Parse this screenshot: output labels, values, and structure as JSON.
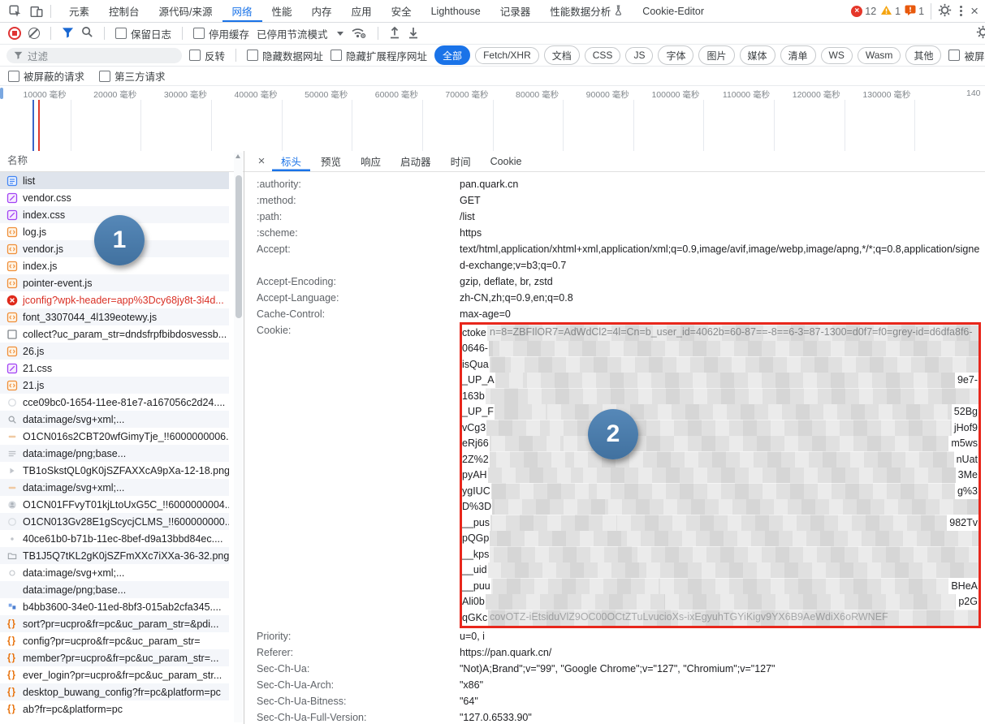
{
  "window": {
    "close_label": "×"
  },
  "tabs": {
    "active": "网络",
    "items": [
      {
        "label": "元素"
      },
      {
        "label": "控制台"
      },
      {
        "label": "源代码/来源"
      },
      {
        "label": "网络"
      },
      {
        "label": "性能"
      },
      {
        "label": "内存"
      },
      {
        "label": "应用"
      },
      {
        "label": "安全"
      },
      {
        "label": "Lighthouse"
      },
      {
        "label": "记录器"
      },
      {
        "label": "性能数据分析",
        "flask": true
      },
      {
        "label": "Cookie-Editor"
      }
    ]
  },
  "badges": {
    "errors": "12",
    "warnings": "1",
    "issues": "1"
  },
  "toolbar": {
    "preserve_log": "保留日志",
    "disable_cache": "停用缓存",
    "throttling": "已停用节流模式"
  },
  "filters": {
    "placeholder": "过滤",
    "invert": "反转",
    "hide_data_urls": "隐藏数据网址",
    "hide_extension_urls": "隐藏扩展程序网址",
    "chips": [
      "全部",
      "Fetch/XHR",
      "文档",
      "CSS",
      "JS",
      "字体",
      "图片",
      "媒体",
      "清单",
      "WS",
      "Wasm",
      "其他"
    ],
    "active_chip": "全部",
    "blocked_response_cookies": "被屏蔽的响应 Cookie",
    "blocked_requests": "被屏蔽的请求",
    "third_party": "第三方请求"
  },
  "timeline": {
    "tick_labels": [
      "10000 毫秒",
      "20000 毫秒",
      "30000 毫秒",
      "40000 毫秒",
      "50000 毫秒",
      "60000 毫秒",
      "70000 毫秒",
      "80000 毫秒",
      "90000 毫秒",
      "100000 毫秒",
      "110000 毫秒",
      "120000 毫秒",
      "130000 毫秒",
      "140"
    ],
    "bar_color": "#5b8def",
    "gray_color": "#d9dbde",
    "gray_bars": [
      [
        12,
        129,
        38
      ],
      [
        75,
        129,
        250
      ],
      [
        470,
        130,
        13
      ]
    ],
    "blue_bars": [
      [
        2,
        140,
        9
      ],
      [
        34,
        140,
        22
      ],
      [
        62,
        141,
        8
      ],
      [
        178,
        140,
        14
      ],
      [
        40,
        146,
        18
      ],
      [
        88,
        147,
        10
      ],
      [
        42,
        151,
        26
      ],
      [
        60,
        152,
        12
      ],
      [
        44,
        156,
        30
      ],
      [
        46,
        161,
        26
      ],
      [
        64,
        162,
        10
      ],
      [
        50,
        166,
        16
      ],
      [
        70,
        167,
        10
      ],
      [
        140,
        167,
        13
      ],
      [
        186,
        167,
        12
      ],
      [
        235,
        167,
        12
      ],
      [
        288,
        167,
        12
      ],
      [
        330,
        167,
        12
      ],
      [
        68,
        172,
        12
      ],
      [
        86,
        172,
        18
      ],
      [
        110,
        173,
        10
      ],
      [
        160,
        173,
        8
      ],
      [
        210,
        172,
        13
      ],
      [
        262,
        172,
        12
      ],
      [
        310,
        172,
        13
      ],
      [
        80,
        178,
        14
      ],
      [
        98,
        179,
        10
      ],
      [
        160,
        180,
        16
      ],
      [
        468,
        136,
        15
      ],
      [
        474,
        141,
        10
      ],
      [
        481,
        149,
        11
      ],
      [
        466,
        160,
        8
      ],
      [
        476,
        160,
        8
      ],
      [
        464,
        172,
        10
      ],
      [
        476,
        172,
        10
      ],
      [
        792,
        139,
        12
      ],
      [
        812,
        140,
        11
      ],
      [
        827,
        133,
        12
      ],
      [
        827,
        137,
        12
      ],
      [
        816,
        149,
        10
      ],
      [
        790,
        163,
        12
      ],
      [
        810,
        164,
        14
      ],
      [
        820,
        171,
        12
      ],
      [
        830,
        177,
        12
      ],
      [
        830,
        181,
        12
      ],
      [
        1018,
        133,
        12
      ],
      [
        1016,
        138,
        10
      ],
      [
        1042,
        149,
        10
      ],
      [
        1016,
        163,
        13
      ]
    ],
    "markers": [
      {
        "x": 40,
        "color": "#3a66c9"
      },
      {
        "x": 47,
        "color": "#e03a2f"
      }
    ]
  },
  "requests": {
    "header": "名称",
    "items": [
      {
        "name": "list",
        "icon": "document",
        "selected": true
      },
      {
        "name": "vendor.css",
        "icon": "stylesheet"
      },
      {
        "name": "index.css",
        "icon": "stylesheet"
      },
      {
        "name": "log.js",
        "icon": "script"
      },
      {
        "name": "vendor.js",
        "icon": "script"
      },
      {
        "name": "index.js",
        "icon": "script"
      },
      {
        "name": "pointer-event.js",
        "icon": "script"
      },
      {
        "name": "jconfig?wpk-header=app%3Dcy68jy8t-3i4d...",
        "icon": "error",
        "error": true
      },
      {
        "name": "font_3307044_4l139eotewy.js",
        "icon": "script"
      },
      {
        "name": "collect?uc_param_str=dndsfrpfbibdosvessb...",
        "icon": "plain"
      },
      {
        "name": "26.js",
        "icon": "script"
      },
      {
        "name": "21.css",
        "icon": "stylesheet"
      },
      {
        "name": "21.js",
        "icon": "script"
      },
      {
        "name": "cce09bc0-1654-11ee-81e7-a167056c2d24....",
        "icon": "img-faint"
      },
      {
        "name": "data:image/svg+xml;...",
        "icon": "img-magnifier"
      },
      {
        "name": "O1CN016s2CBT20wfGimyTje_!!6000000006...",
        "icon": "img-dash"
      },
      {
        "name": "data:image/png;base...",
        "icon": "img-lines"
      },
      {
        "name": "TB1oSkstQL0gK0jSZFAXXcA9pXa-12-18.png",
        "icon": "img-arrow"
      },
      {
        "name": "data:image/svg+xml;...",
        "icon": "img-dash"
      },
      {
        "name": "O1CN01FFvyT01kjLtoUxG5C_!!6000000004...",
        "icon": "img-avatar"
      },
      {
        "name": "O1CN013Gv28E1gScycjCLMS_!!600000000...",
        "icon": "img-faint"
      },
      {
        "name": "40ce61b0-b71b-11ec-8bef-d9a13bbd84ec....",
        "icon": "img-dot"
      },
      {
        "name": "TB1J5Q7tKL2gK0jSZFmXXc7iXXa-36-32.png",
        "icon": "img-folder"
      },
      {
        "name": "data:image/svg+xml;...",
        "icon": "img-circle"
      },
      {
        "name": "data:image/png;base...",
        "icon": "img-blank"
      },
      {
        "name": "b4bb3600-34e0-11ed-8bf3-015ab2cfa345....",
        "icon": "img-blue"
      },
      {
        "name": "sort?pr=ucpro&fr=pc&uc_param_str=&pdi...",
        "icon": "fetch"
      },
      {
        "name": "config?pr=ucpro&fr=pc&uc_param_str=",
        "icon": "fetch"
      },
      {
        "name": "member?pr=ucpro&fr=pc&uc_param_str=...",
        "icon": "fetch"
      },
      {
        "name": "ever_login?pr=ucpro&fr=pc&uc_param_str...",
        "icon": "fetch"
      },
      {
        "name": "desktop_buwang_config?fr=pc&platform=pc",
        "icon": "fetch"
      },
      {
        "name": "ab?fr=pc&platform=pc",
        "icon": "fetch"
      }
    ]
  },
  "details": {
    "close": "×",
    "tabs": [
      "标头",
      "预览",
      "响应",
      "启动器",
      "时间",
      "Cookie"
    ],
    "active_tab": "标头",
    "headers_top": [
      {
        "name": ":authority:",
        "value": "pan.quark.cn"
      },
      {
        "name": ":method:",
        "value": "GET"
      },
      {
        "name": ":path:",
        "value": "/list"
      },
      {
        "name": ":scheme:",
        "value": "https"
      },
      {
        "name": "Accept:",
        "value": "text/html,application/xhtml+xml,application/xml;q=0.9,image/avif,image/webp,image/apng,*/*;q=0.8,application/signed-exchange;v=b3;q=0.7"
      },
      {
        "name": "Accept-Encoding:",
        "value": "gzip, deflate, br, zstd"
      },
      {
        "name": "Accept-Language:",
        "value": "zh-CN,zh;q=0.9,en;q=0.8"
      },
      {
        "name": "Cache-Control:",
        "value": "max-age=0"
      }
    ],
    "cookie": {
      "name": "Cookie:",
      "lines": [
        {
          "left": "ctoke",
          "right": "",
          "ghost": "n=8=ZBFIlOR7=AdWdCl2=4l=Cn=b_user_id=4062b=60-87==-8==6-3=87-1300=d0f7=f0=grey-id=d6dfa8f6-"
        },
        {
          "left": "0646-",
          "right": ""
        },
        {
          "left": "isQua",
          "right": ""
        },
        {
          "left": "_UP_A",
          "right": "9e7-"
        },
        {
          "left": "163b",
          "right": ""
        },
        {
          "left": "_UP_F",
          "right": "52Bg"
        },
        {
          "left": "vCg3",
          "right": "jHof9"
        },
        {
          "left": "eRj66",
          "right": "m5ws"
        },
        {
          "left": "2Z%2",
          "right": "nUat"
        },
        {
          "left": "pyAH",
          "right": "3Me"
        },
        {
          "left": "ygIUC",
          "right": "g%3"
        },
        {
          "left": "D%3D",
          "right": ""
        },
        {
          "left": "__pus",
          "right": "982Tv"
        },
        {
          "left": "pQGp",
          "right": ""
        },
        {
          "left": "__kps",
          "right": ""
        },
        {
          "left": "__uid",
          "right": ""
        },
        {
          "left": "__puu",
          "right": "BHeA"
        },
        {
          "left": "Ali0b",
          "right": "p2G"
        },
        {
          "left": "qGKc",
          "right": "",
          "ghost": "covOTZ-iEtsiduVlZ9OC00OCtZTuLvucioXs-ixEgyuhTGYiKigv9YX6B9AeWdiX6oRWNEF"
        }
      ]
    },
    "headers_bottom": [
      {
        "name": "Priority:",
        "value": "u=0, i"
      },
      {
        "name": "Referer:",
        "value": "https://pan.quark.cn/"
      },
      {
        "name": "Sec-Ch-Ua:",
        "value": "\"Not)A;Brand\";v=\"99\", \"Google Chrome\";v=\"127\", \"Chromium\";v=\"127\""
      },
      {
        "name": "Sec-Ch-Ua-Arch:",
        "value": "\"x86\""
      },
      {
        "name": "Sec-Ch-Ua-Bitness:",
        "value": "\"64\""
      },
      {
        "name": "Sec-Ch-Ua-Full-Version:",
        "value": "\"127.0.6533.90\""
      }
    ]
  },
  "annotations": {
    "step1": "1",
    "step2": "2"
  },
  "colors": {
    "accent": "#1a73e8",
    "error": "#d93025",
    "warning": "#f5a40f",
    "redbox": "#e8271c",
    "annotation": "#4b7cab"
  }
}
